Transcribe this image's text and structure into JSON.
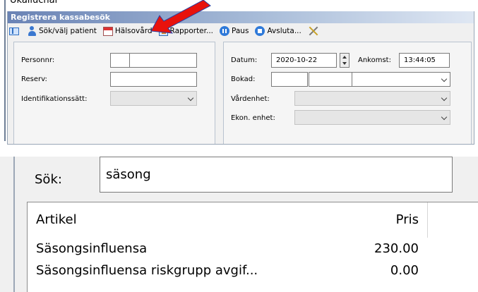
{
  "top_fragment_text": "Ukalluchar",
  "window": {
    "title": "Registrera kassabesök"
  },
  "toolbar": {
    "items": [
      {
        "icon": "panel-icon",
        "label": ""
      },
      {
        "icon": "patient-icon",
        "label": "Sök/välj patient"
      },
      {
        "icon": "calendar-icon",
        "label": "Hälsovård"
      },
      {
        "icon": "report-icon",
        "label": "Rapporter..."
      },
      {
        "icon": "pause-icon",
        "label": "Paus"
      },
      {
        "icon": "stop-icon",
        "label": "Avsluta..."
      },
      {
        "icon": "tools-icon",
        "label": ""
      }
    ]
  },
  "left_form": {
    "personnr_label": "Personnr:",
    "reserv_label": "Reserv:",
    "identifikation_label": "Identifikationssätt:"
  },
  "right_form": {
    "datum_label": "Datum:",
    "datum_value": "2020-10-22",
    "ankomst_label": "Ankomst:",
    "ankomst_value": "13:44:05",
    "bokad_label": "Bokad:",
    "vardenhet_label": "Vårdenhet:",
    "ekon_label": "Ekon. enhet:"
  },
  "annotation": {
    "arrow_color": "#e8120c"
  },
  "search": {
    "label": "Sök:",
    "value": "säsong"
  },
  "results": {
    "columns": [
      "Artikel",
      "Pris"
    ],
    "rows": [
      {
        "artikel": "Säsongsinfluensa",
        "pris": "230.00"
      },
      {
        "artikel": "Säsongsinfluensa riskgrupp avgif...",
        "pris": "0.00"
      }
    ]
  }
}
